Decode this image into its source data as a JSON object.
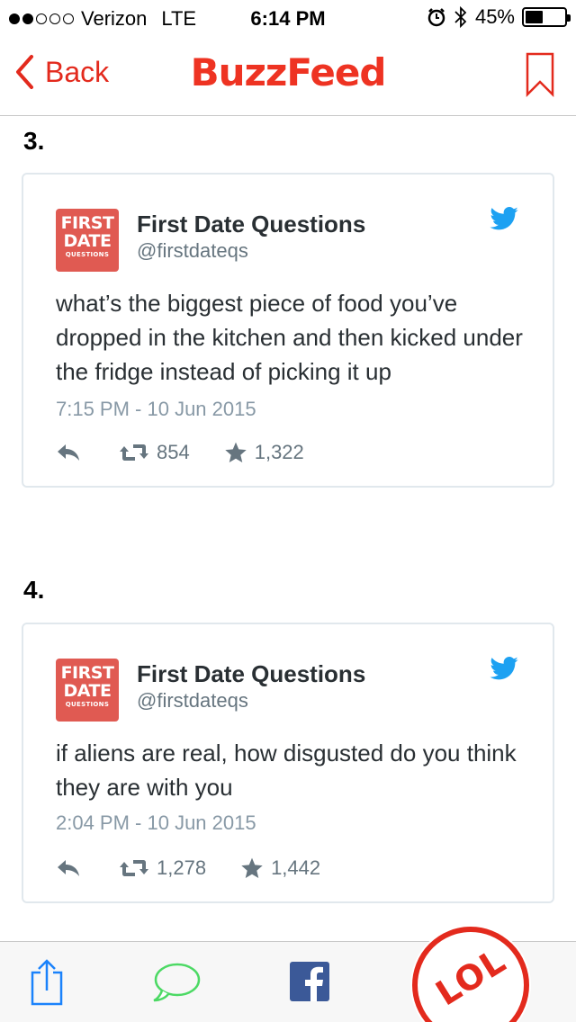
{
  "status_bar": {
    "carrier": "Verizon",
    "network": "LTE",
    "time": "6:14 PM",
    "battery_text": "45%",
    "battery_level": 0.45,
    "signal_bars": 2
  },
  "nav": {
    "back_label": "Back",
    "logo": "BuzzFeed"
  },
  "items": [
    {
      "number": "3.",
      "tweet": {
        "avatar_line1": "FIRST",
        "avatar_line2": "DATE",
        "avatar_line3": "QUESTIONS",
        "name": "First Date Questions",
        "handle": "@firstdateqs",
        "text": "what’s the biggest piece of food you’ve dropped in the kitchen and then kicked under the fridge instead of picking it up",
        "timestamp": "7:15 PM - 10 Jun 2015",
        "retweets": "854",
        "favorites": "1,322"
      }
    },
    {
      "number": "4.",
      "tweet": {
        "avatar_line1": "FIRST",
        "avatar_line2": "DATE",
        "avatar_line3": "QUESTIONS",
        "name": "First Date Questions",
        "handle": "@firstdateqs",
        "text": "if aliens are real, how disgusted do you think they are with you",
        "timestamp": "2:04 PM - 10 Jun 2015",
        "retweets": "1,278",
        "favorites": "1,442"
      }
    }
  ],
  "tab_bar": {
    "share_icon": "share-icon",
    "comment_icon": "comment-icon",
    "facebook_icon": "facebook-icon",
    "lol_label": "LOL"
  },
  "colors": {
    "brand": "#ee3322",
    "twitter": "#1da1f2",
    "facebook": "#3b5998",
    "imessage_green": "#4cd964",
    "ios_blue": "#1a82fb"
  }
}
